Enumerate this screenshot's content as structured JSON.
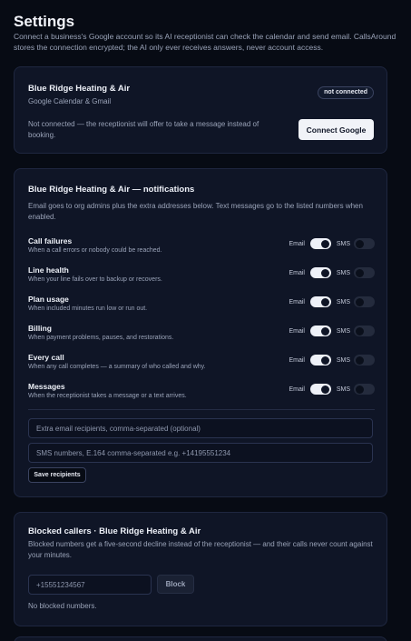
{
  "page": {
    "title": "Settings",
    "intro": "Connect a business's Google account so its AI receptionist can check the calendar and send email. CallsAround stores the connection encrypted; the AI only ever receives answers, never account access."
  },
  "google": {
    "business": "Blue Ridge Heating & Air",
    "service": "Google Calendar & Gmail",
    "status_badge": "not connected",
    "note": "Not connected — the receptionist will offer to take a message instead of booking.",
    "connect_label": "Connect Google"
  },
  "notifications": {
    "title": "Blue Ridge Heating & Air — notifications",
    "description": "Email goes to org admins plus the extra addresses below. Text messages go to the listed numbers when enabled.",
    "email_label": "Email",
    "sms_label": "SMS",
    "items": [
      {
        "title": "Call failures",
        "desc": "When a call errors or nobody could be reached.",
        "email": true,
        "sms": false
      },
      {
        "title": "Line health",
        "desc": "When your line fails over to backup or recovers.",
        "email": true,
        "sms": false
      },
      {
        "title": "Plan usage",
        "desc": "When included minutes run low or run out.",
        "email": true,
        "sms": false
      },
      {
        "title": "Billing",
        "desc": "When payment problems, pauses, and restorations.",
        "email": true,
        "sms": false
      },
      {
        "title": "Every call",
        "desc": "When any call completes — a summary of who called and why.",
        "email": true,
        "sms": false
      },
      {
        "title": "Messages",
        "desc": "When the receptionist takes a message or a text arrives.",
        "email": true,
        "sms": false
      }
    ],
    "email_recipients_placeholder": "Extra email recipients, comma-separated (optional)",
    "sms_numbers_placeholder": "SMS numbers, E.164 comma-separated e.g. +14195551234",
    "save_label": "Save recipients"
  },
  "blocked": {
    "title": "Blocked callers · Blue Ridge Heating & Air",
    "description": "Blocked numbers get a five-second decline instead of the receptionist — and their calls never count against your minutes.",
    "input_placeholder": "+15551234567",
    "block_label": "Block",
    "empty_text": "No blocked numbers."
  }
}
